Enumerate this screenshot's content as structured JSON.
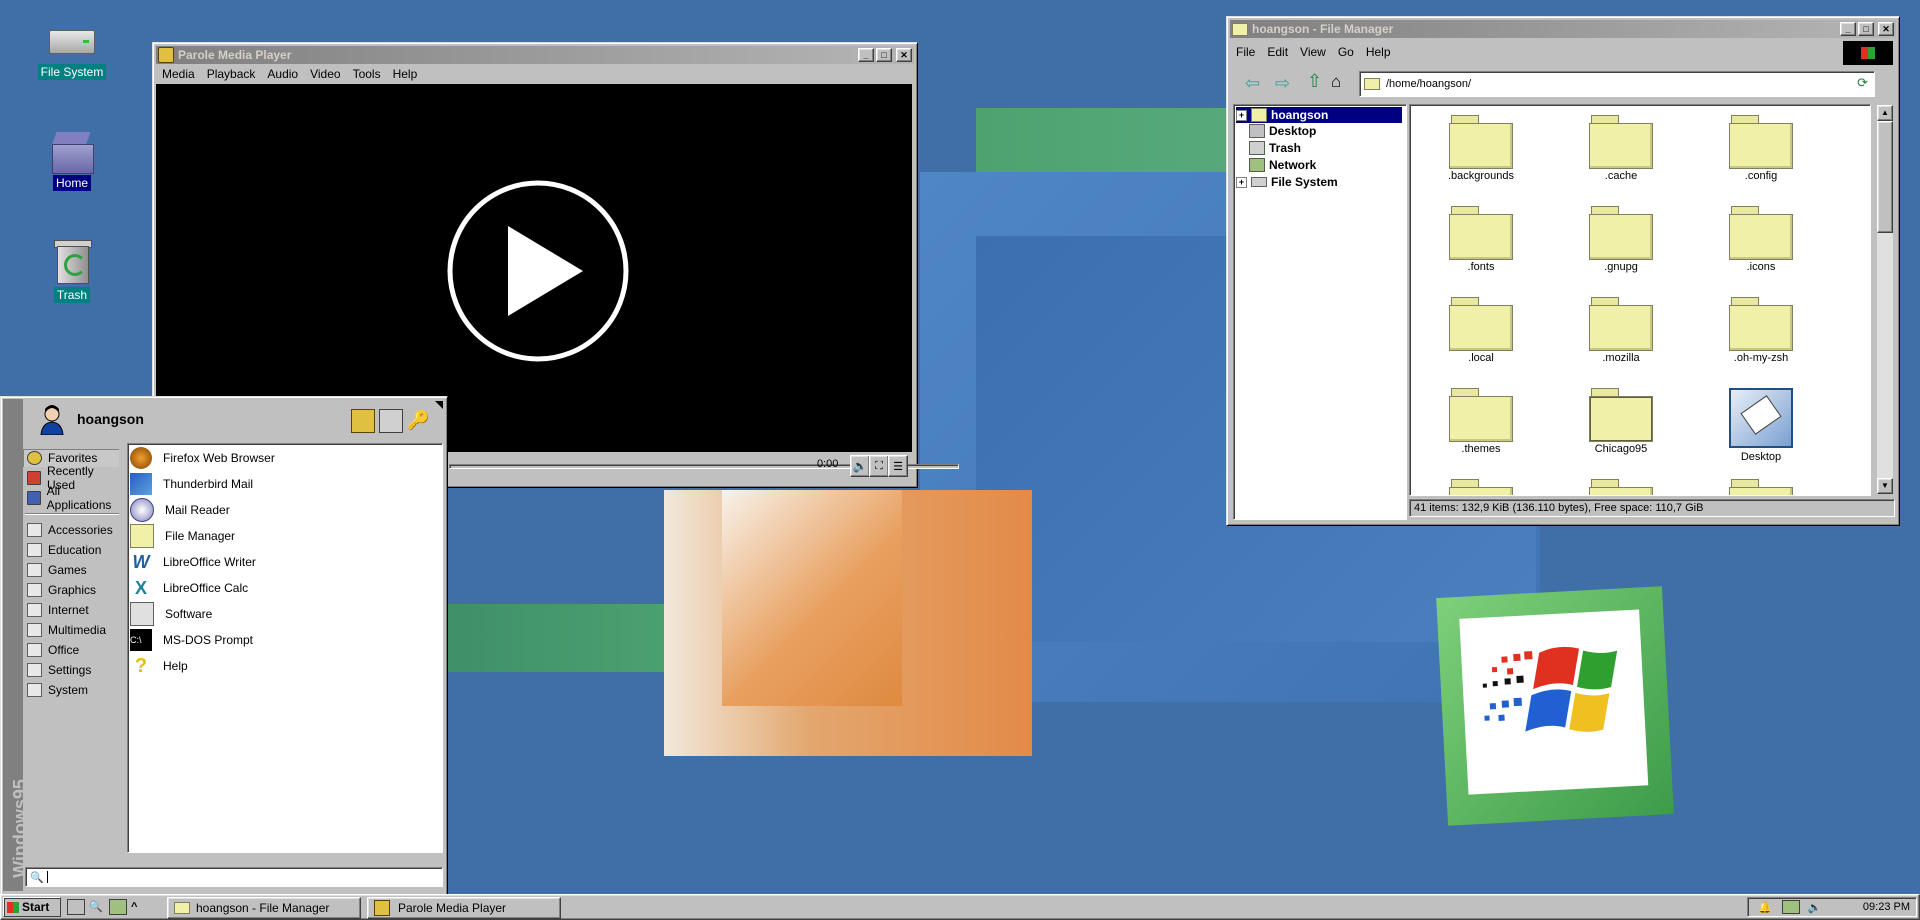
{
  "desktop": {
    "icons": [
      {
        "label": "File System",
        "icon": "drive-icon"
      },
      {
        "label": "Home",
        "icon": "home-folder-icon"
      },
      {
        "label": "Trash",
        "icon": "recycle-bin-icon"
      }
    ]
  },
  "media_player": {
    "title": "Parole Media Player",
    "menu": [
      "Media",
      "Playback",
      "Audio",
      "Video",
      "Tools",
      "Help"
    ],
    "time": "0:00",
    "progress": 0
  },
  "file_manager": {
    "title": "hoangson - File Manager",
    "menu": [
      "File",
      "Edit",
      "View",
      "Go",
      "Help"
    ],
    "path": "/home/hoangson/",
    "tree": [
      {
        "label": "hoangson",
        "selected": true,
        "expander": "+"
      },
      {
        "label": "Desktop"
      },
      {
        "label": "Trash"
      },
      {
        "label": "Network"
      },
      {
        "label": "File System",
        "expander": "+"
      }
    ],
    "items": [
      ".backgrounds",
      ".cache",
      ".config",
      ".fonts",
      ".gnupg",
      ".icons",
      ".local",
      ".mozilla",
      ".oh-my-zsh",
      ".themes",
      "Chicago95",
      "Desktop"
    ],
    "status": "41 items: 132,9 KiB (136.110 bytes), Free space: 110,7 GiB"
  },
  "start_menu": {
    "user": "hoangson",
    "brand": "Windows95",
    "nav": [
      "Favorites",
      "Recently Used",
      "All Applications"
    ],
    "categories": [
      "Accessories",
      "Education",
      "Games",
      "Graphics",
      "Internet",
      "Multimedia",
      "Office",
      "Settings",
      "System"
    ],
    "apps": [
      "Firefox Web Browser",
      "Thunderbird Mail",
      "Mail Reader",
      "File Manager",
      "LibreOffice Writer",
      "LibreOffice Calc",
      "Software",
      "MS-DOS Prompt",
      "Help"
    ],
    "search_value": ""
  },
  "taskbar": {
    "start_label": "Start",
    "tasks": [
      "hoangson - File Manager",
      "Parole Media Player"
    ],
    "clock": "09:23 PM",
    "quicklaunch_more": "^"
  },
  "colors": {
    "desktop_bg": "#3f6fa6",
    "selection": "#000080",
    "win_face": "#c0c0c0"
  }
}
